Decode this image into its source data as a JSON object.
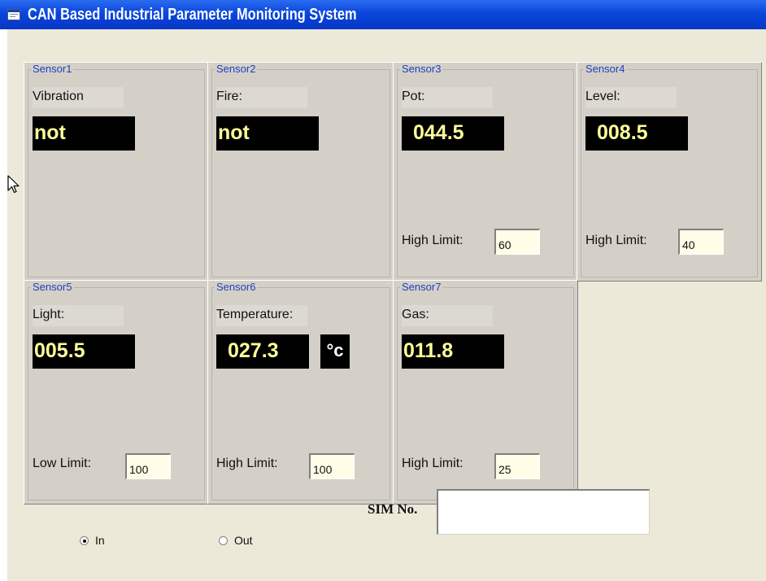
{
  "window": {
    "title": "CAN Based Industrial Parameter Monitoring System",
    "icon": "app-window-icon"
  },
  "sensors": [
    {
      "frame": "Sensor1",
      "name": "Vibration",
      "value": "not",
      "limit_label": "",
      "limit_value": ""
    },
    {
      "frame": "Sensor2",
      "name": "Fire:",
      "value": "not",
      "limit_label": "",
      "limit_value": ""
    },
    {
      "frame": "Sensor3",
      "name": "Pot:",
      "value": "044.5",
      "limit_label": "High Limit:",
      "limit_value": "60"
    },
    {
      "frame": "Sensor4",
      "name": "Level:",
      "value": "008.5",
      "limit_label": "High Limit:",
      "limit_value": "40"
    },
    {
      "frame": "Sensor5",
      "name": "Light:",
      "value": "005.5",
      "limit_label": "Low Limit:",
      "limit_value": "100"
    },
    {
      "frame": "Sensor6",
      "name": "Temperature:",
      "value": "027.3",
      "unit": "°c",
      "limit_label": "High Limit:",
      "limit_value": "100"
    },
    {
      "frame": "Sensor7",
      "name": "Gas:",
      "value": "011.8",
      "limit_label": "High Limit:",
      "limit_value": "25"
    }
  ],
  "mode": {
    "in_label": "In",
    "out_label": "Out",
    "selected": "In"
  },
  "sim": {
    "label": "SIM No.",
    "value": ""
  },
  "colors": {
    "titlebar": "#0a46dc",
    "panel": "#d4d0c8",
    "display_bg": "#000000",
    "display_text": "#ffff99",
    "frame_label": "#2040c0",
    "limit_input_bg": "#fffde7"
  }
}
